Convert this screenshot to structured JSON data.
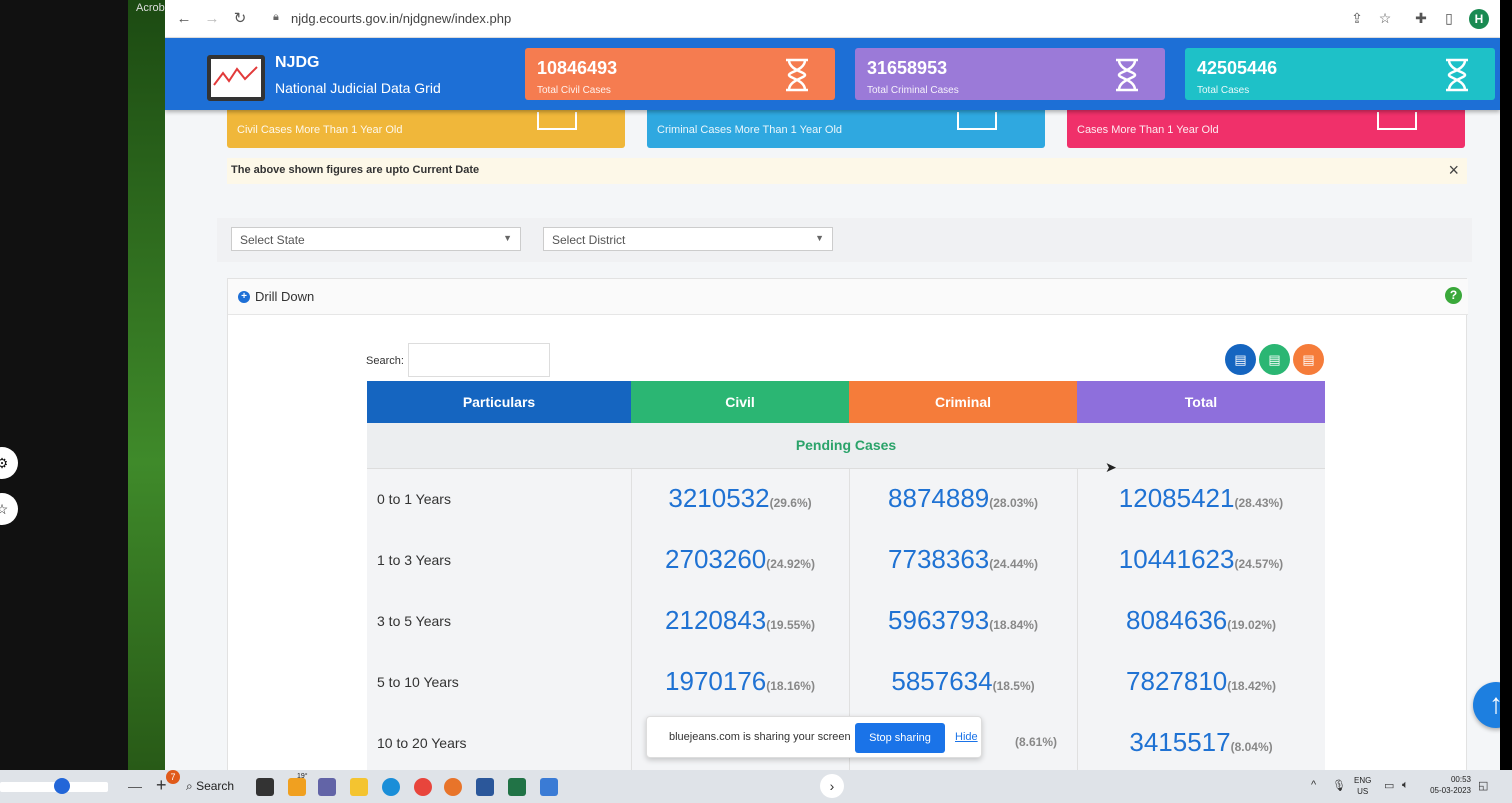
{
  "os": {
    "app_label": "Acrob",
    "search_label": "Search",
    "badge_count": "7",
    "lang": "ENG",
    "lang_sub": "US",
    "time": "00:53",
    "date": "05-03-2023",
    "weather": "19°"
  },
  "browser": {
    "url": "njdg.ecourts.gov.in/njdgnew/index.php",
    "profile_initial": "H"
  },
  "header": {
    "title": "NJDG",
    "subtitle": "National Judicial Data Grid",
    "cards": [
      {
        "value": "10846493",
        "label": "Total Civil Cases",
        "color": "#f57c50"
      },
      {
        "value": "31658953",
        "label": "Total Criminal Cases",
        "color": "#9b7ad8"
      },
      {
        "value": "42505446",
        "label": "Total Cases",
        "color": "#1ec1c8"
      }
    ]
  },
  "subcards": [
    {
      "label": "Civil Cases More Than 1 Year Old",
      "color": "#f0b73a"
    },
    {
      "label": "Criminal Cases More Than 1 Year Old",
      "color": "#2fa8e0"
    },
    {
      "label": "Cases More Than 1 Year Old",
      "color": "#f0306a"
    }
  ],
  "notice": "The above shown figures are upto Current Date",
  "filters": {
    "state": "Select State",
    "district": "Select District"
  },
  "panel": {
    "title": "Drill Down",
    "search_label": "Search:"
  },
  "table": {
    "headers": [
      "Particulars",
      "Civil",
      "Criminal",
      "Total"
    ],
    "header_colors": [
      "#1565c0",
      "#2bb673",
      "#f57c3a",
      "#8e6fdc"
    ],
    "section": "Pending Cases",
    "rows": [
      {
        "label": "0 to 1 Years",
        "civil": "3210532",
        "civil_pct": "(29.6%)",
        "criminal": "8874889",
        "criminal_pct": "(28.03%)",
        "total": "12085421",
        "total_pct": "(28.43%)"
      },
      {
        "label": "1 to 3 Years",
        "civil": "2703260",
        "civil_pct": "(24.92%)",
        "criminal": "7738363",
        "criminal_pct": "(24.44%)",
        "total": "10441623",
        "total_pct": "(24.57%)"
      },
      {
        "label": "3 to 5 Years",
        "civil": "2120843",
        "civil_pct": "(19.55%)",
        "criminal": "5963793",
        "criminal_pct": "(18.84%)",
        "total": "8084636",
        "total_pct": "(19.02%)"
      },
      {
        "label": "5 to 10 Years",
        "civil": "1970176",
        "civil_pct": "(18.16%)",
        "criminal": "5857634",
        "criminal_pct": "(18.5%)",
        "total": "7827810",
        "total_pct": "(18.42%)"
      },
      {
        "label": "10 to 20 Years",
        "civil": "",
        "civil_pct": "",
        "criminal": "",
        "criminal_pct": "(8.61%)",
        "total": "3415517",
        "total_pct": "(8.04%)"
      }
    ]
  },
  "share": {
    "text": "bluejeans.com is sharing your screen",
    "stop": "Stop sharing",
    "hide": "Hide"
  }
}
